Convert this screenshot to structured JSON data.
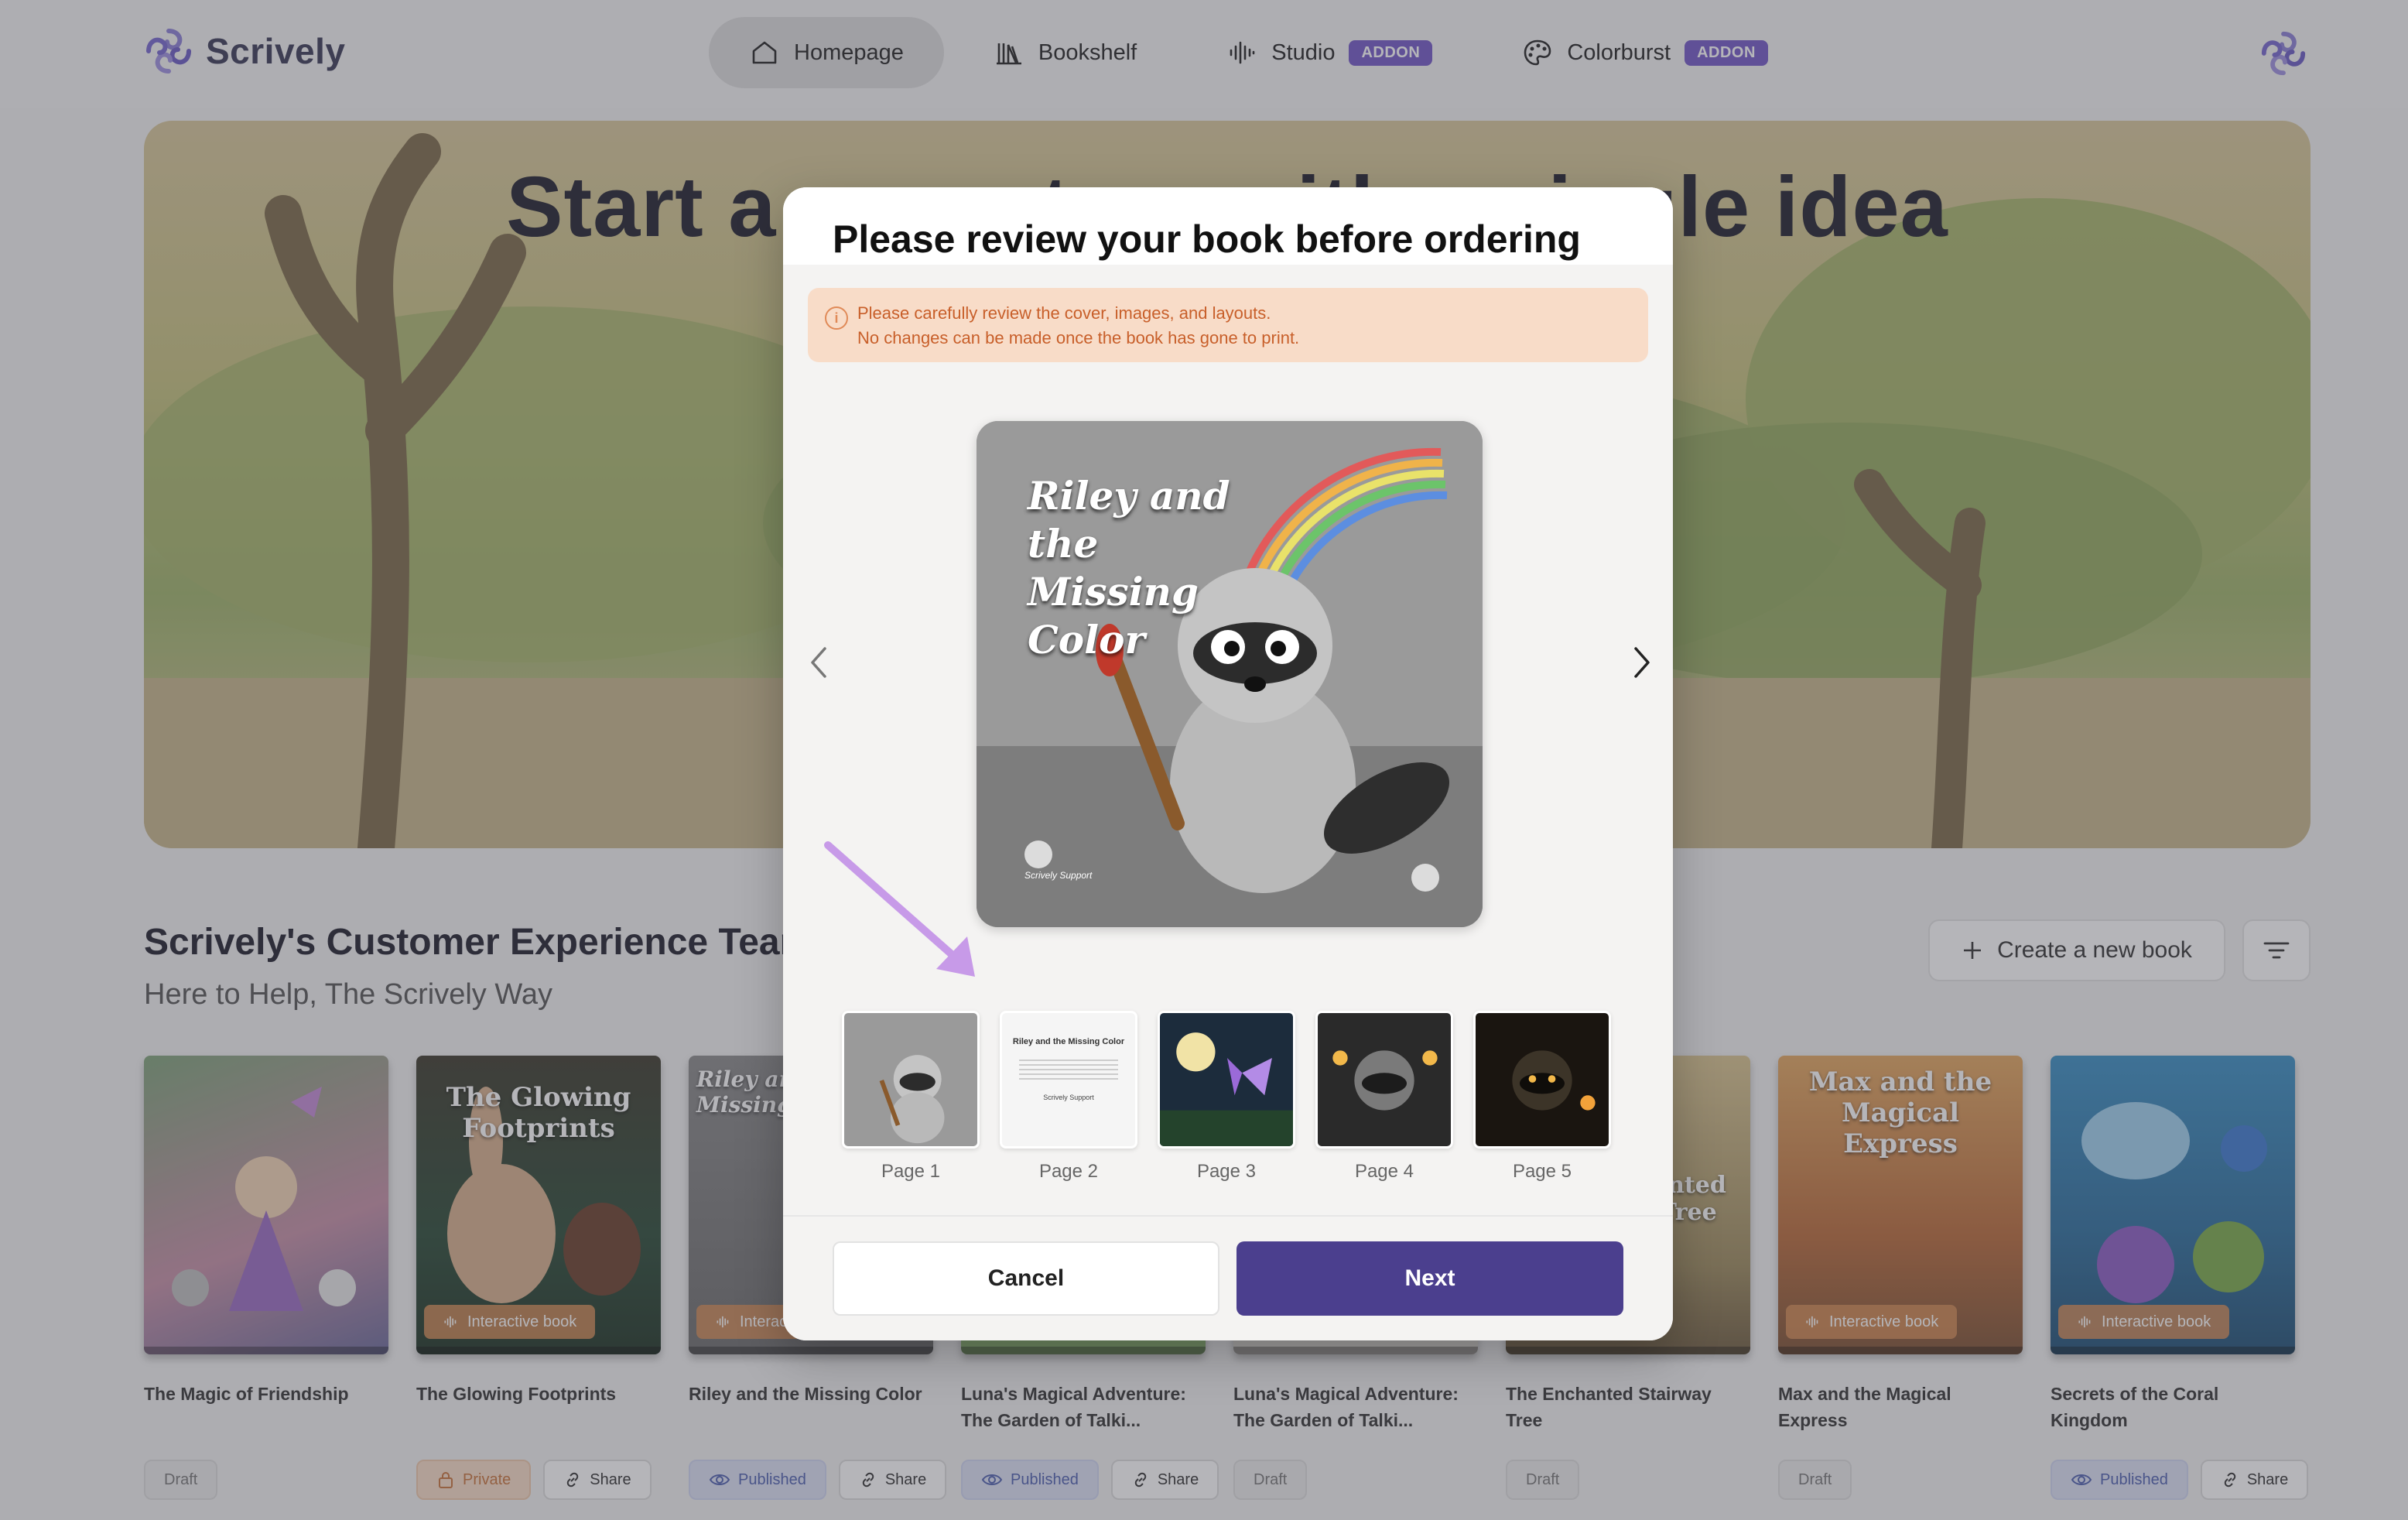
{
  "app": {
    "name": "Scrively"
  },
  "nav": {
    "items": [
      {
        "label": "Homepage",
        "icon": "home-icon",
        "active": true
      },
      {
        "label": "Bookshelf",
        "icon": "bookshelf-icon",
        "active": false
      },
      {
        "label": "Studio",
        "icon": "audio-wave-icon",
        "badge": "ADDON",
        "active": false
      },
      {
        "label": "Colorburst",
        "icon": "palette-icon",
        "badge": "ADDON",
        "active": false
      }
    ]
  },
  "hero": {
    "title": "Start a new story with a single idea"
  },
  "section": {
    "title": "Scrively's Customer Experience Team",
    "subtitle": "Here to Help, The Scrively Way",
    "create_label": "Create a new book",
    "filter_icon": "filter-icon"
  },
  "books": [
    {
      "title": "The Magic of Friendship",
      "cover_text": "",
      "interactive": false,
      "tags": [
        "Draft"
      ]
    },
    {
      "title": "The Glowing Footprints",
      "cover_text": "The Glowing Footprints",
      "interactive": true,
      "interactive_label": "Interactive book",
      "tags": [
        "Private",
        "Share"
      ]
    },
    {
      "title": "Riley and the Missing Color",
      "cover_text": "Riley and the Missing Color",
      "interactive": true,
      "interactive_label": "Interactive book",
      "tags": [
        "Published",
        "Share"
      ]
    },
    {
      "title": "Luna's Magical Adventure: The Garden of Talki...",
      "cover_text": "",
      "interactive": false,
      "tags": [
        "Published",
        "Share"
      ]
    },
    {
      "title": "Luna's Magical Adventure: The Garden of Talki...",
      "cover_text": "",
      "interactive": false,
      "tags": [
        "Draft"
      ]
    },
    {
      "title": "The Enchanted Stairway Tree",
      "cover_text": "The Enchanted Stairway Tree",
      "interactive": false,
      "tags": [
        "Draft"
      ]
    },
    {
      "title": "Max and the Magical Express",
      "cover_text": "Max and the Magical Express",
      "interactive": true,
      "interactive_label": "Interactive book",
      "tags": [
        "Draft"
      ]
    },
    {
      "title": "Secrets of the Coral Kingdom",
      "cover_text": "",
      "interactive": true,
      "interactive_label": "Interactive book",
      "tags": [
        "Published",
        "Share"
      ]
    }
  ],
  "modal": {
    "title": "Please review your book before ordering",
    "warning_line1": "Please carefully review the cover, images, and layouts.",
    "warning_line2": "No changes can be made once the book has gone to print.",
    "preview_title": "Riley and the Missing Color",
    "preview_credit": "Scrively Support",
    "pages": [
      {
        "label": "Page 1"
      },
      {
        "label": "Page 2",
        "title": "Riley and the Missing Color",
        "signature": "Scrively Support"
      },
      {
        "label": "Page 3"
      },
      {
        "label": "Page 4"
      },
      {
        "label": "Page 5"
      }
    ],
    "cancel_label": "Cancel",
    "next_label": "Next"
  },
  "colors": {
    "accent": "#4b3f8e",
    "addon_badge": "#7257c7",
    "warning_bg": "#f8dcc8",
    "warning_text": "#c85f2a"
  }
}
